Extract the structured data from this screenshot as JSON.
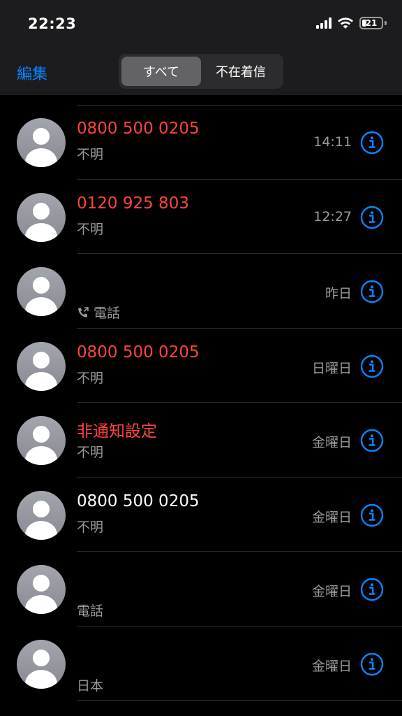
{
  "status_bar": {
    "time": "22:23",
    "battery_level": "21"
  },
  "nav": {
    "edit_label": "編集",
    "segments": [
      "すべて",
      "不在着信"
    ],
    "active_segment": "すべて"
  },
  "colors": {
    "missed": "#ff453a",
    "accent": "#0a84ff",
    "secondary_text": "#9a9a9e",
    "background": "#000000",
    "header": "#1c1c1e"
  },
  "calls": [
    {
      "caller": "0800 500 0205",
      "subtitle": "不明",
      "time": "14:11",
      "missed": true,
      "icon": ""
    },
    {
      "caller": "0120 925 803",
      "subtitle": "不明",
      "time": "12:27",
      "missed": true,
      "icon": ""
    },
    {
      "caller": "",
      "subtitle": "電話",
      "time": "昨日",
      "missed": false,
      "icon": "outgoing-call-icon"
    },
    {
      "caller": "0800 500 0205",
      "subtitle": "不明",
      "time": "日曜日",
      "missed": true,
      "icon": ""
    },
    {
      "caller": "非通知設定",
      "subtitle": "不明",
      "time": "金曜日",
      "missed": true,
      "icon": ""
    },
    {
      "caller": "0800 500 0205",
      "subtitle": "不明",
      "time": "金曜日",
      "missed": false,
      "icon": ""
    },
    {
      "caller": "",
      "subtitle": "電話",
      "time": "金曜日",
      "missed": false,
      "icon": ""
    },
    {
      "caller": "",
      "subtitle": "日本",
      "time": "金曜日",
      "missed": false,
      "icon": ""
    }
  ]
}
